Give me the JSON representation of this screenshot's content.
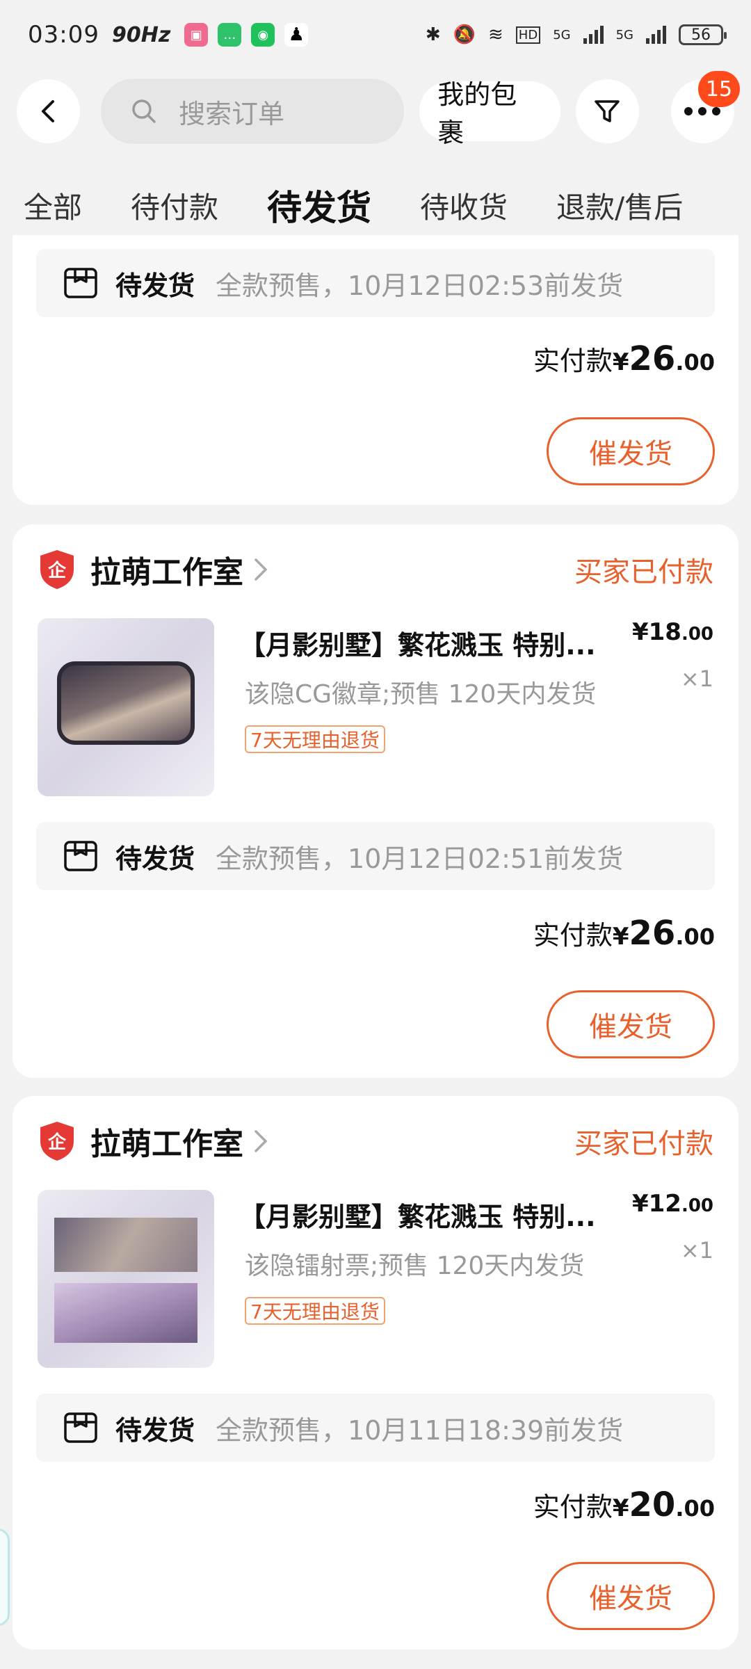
{
  "status_bar": {
    "time": "03:09",
    "refresh_rate": "90Hz",
    "battery": "56",
    "network_1": "5G",
    "network_2": "5G",
    "hd_label": "HD"
  },
  "header": {
    "search_placeholder": "搜索订单",
    "my_packages": "我的包裹",
    "more_badge": "15"
  },
  "tabs": [
    {
      "label": "全部"
    },
    {
      "label": "待付款"
    },
    {
      "label": "待发货"
    },
    {
      "label": "待收货"
    },
    {
      "label": "退款/售后"
    }
  ],
  "orders": [
    {
      "ship_title": "待发货",
      "ship_note": "全款预售，10月12日02:53前发货",
      "paid_label": "实付款",
      "paid_currency": "¥",
      "paid_int": "26",
      "paid_dec": ".00",
      "urge_label": "催发货"
    },
    {
      "shop": "拉萌工作室",
      "status": "买家已付款",
      "title": "【月影别墅】繁花溅玉 特别...",
      "desc": "该隐CG徽章;预售 120天内发货",
      "tag": "7天无理由退货",
      "price_int": "¥18",
      "price_dec": ".00",
      "qty": "×1",
      "ship_title": "待发货",
      "ship_note": "全款预售，10月12日02:51前发货",
      "paid_label": "实付款",
      "paid_currency": "¥",
      "paid_int": "26",
      "paid_dec": ".00",
      "urge_label": "催发货"
    },
    {
      "shop": "拉萌工作室",
      "status": "买家已付款",
      "title": "【月影别墅】繁花溅玉 特别...",
      "desc": "该隐镭射票;预售 120天内发货",
      "tag": "7天无理由退货",
      "price_int": "¥12",
      "price_dec": ".00",
      "qty": "×1",
      "ship_title": "待发货",
      "ship_note": "全款预售，10月11日18:39前发货",
      "paid_label": "实付款",
      "paid_currency": "¥",
      "paid_int": "20",
      "paid_dec": ".00",
      "urge_label": "催发货"
    }
  ],
  "colors": {
    "accent": "#e8612c",
    "badge": "#ff4a1c",
    "shop_shield": "#e53935"
  }
}
